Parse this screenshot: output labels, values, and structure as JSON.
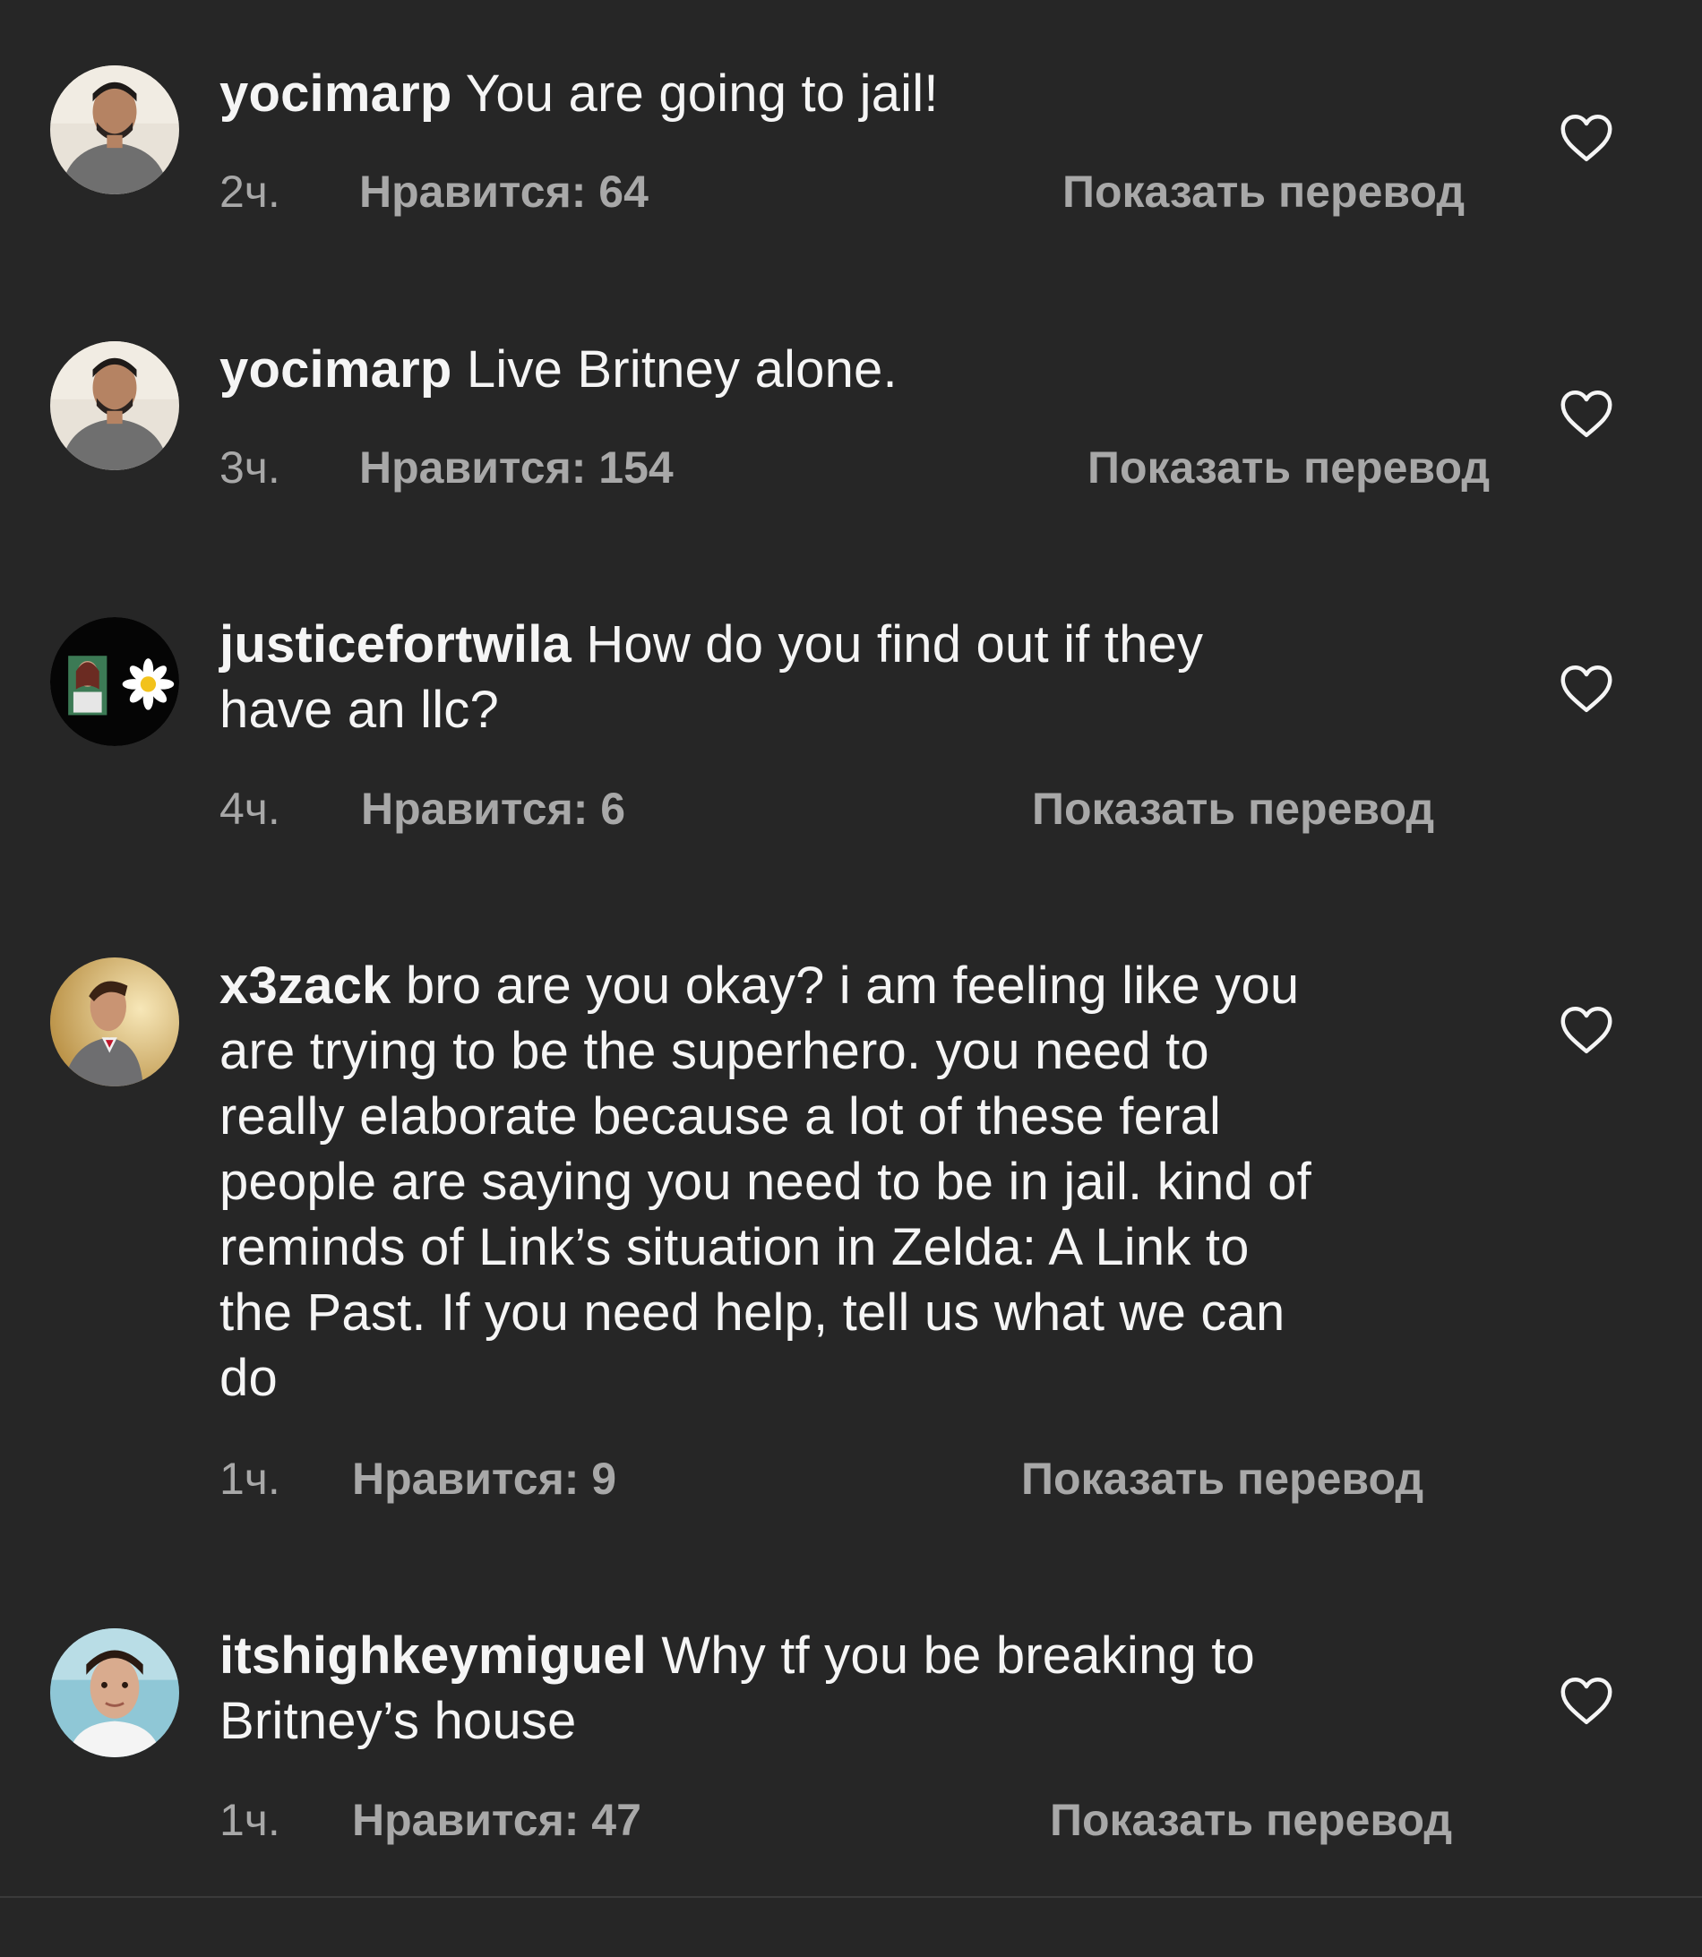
{
  "comments": [
    {
      "username": "yocimarp",
      "text": "You are going to jail!",
      "lines": [
        "You are going to jail!"
      ],
      "time": "2ч.",
      "likes": "Нравится: 64",
      "translate": "Показать перевод",
      "avatar": "man-in-grey-shirt-avatar"
    },
    {
      "username": "yocimarp",
      "text": "Live Britney alone.",
      "lines": [
        "Live Britney alone."
      ],
      "time": "3ч.",
      "likes": "Нравится: 154",
      "translate": "Показать перевод",
      "avatar": "man-in-grey-shirt-avatar"
    },
    {
      "username": "justicefortwila",
      "text": "How do you find out if they have an llc?",
      "line1": "How do you find out if they",
      "line2": "have an llc?",
      "time": "4ч.",
      "likes": "Нравится: 6",
      "translate": "Показать перевод",
      "avatar": "photo-and-daisy-avatar"
    },
    {
      "username": "x3zack",
      "text": "bro are you okay? i am feeling like you are trying to be the superhero. you need to really elaborate because a lot of these feral people are saying you need to be in jail. kind of reminds of Link’s situation in Zelda: A Link to the Past. If you need help, tell us what we can do",
      "line1": "bro are you okay? i am feeling like you",
      "line2": "are trying to be the superhero. you need to",
      "line3": "really elaborate because a lot of these feral",
      "line4": "people are saying you need to be in jail. kind of",
      "line5": "reminds of Link’s situation in Zelda: A Link to",
      "line6": "the Past. If you need help, tell us what we can",
      "line7": "do",
      "time": "1ч.",
      "likes": "Нравится: 9",
      "translate": "Показать перевод",
      "avatar": "man-in-suit-profile-avatar"
    },
    {
      "username": "itshighkeymiguel",
      "text": "Why tf you be breaking to Britney’s house",
      "line1": "Why tf you be breaking to",
      "line2": "Britney’s house",
      "time": "1ч.",
      "likes": "Нравится: 47",
      "translate": "Показать перевод",
      "avatar": "young-man-selfie-avatar"
    }
  ],
  "icons": {
    "like": "heart-outline-icon"
  },
  "colors": {
    "background": "#262626",
    "primary_text": "#f5f5f5",
    "secondary_text": "#a8a8a8"
  }
}
